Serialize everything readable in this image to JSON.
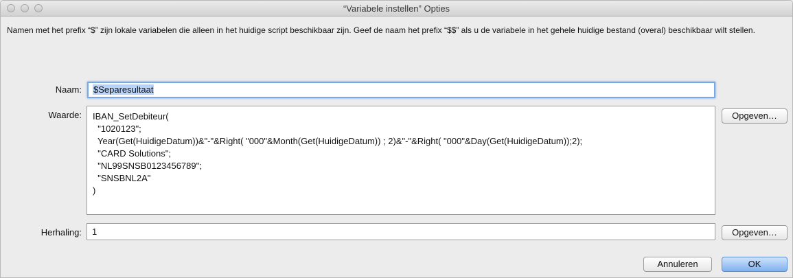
{
  "window": {
    "title": "“Variabele instellen” Opties"
  },
  "description": "Namen met het prefix “$” zijn lokale variabelen die alleen in het huidige script beschikbaar zijn. Geef de naam het prefix “$$” als u de variabele in het gehele huidige bestand (overal) beschikbaar wilt stellen.",
  "name": {
    "label": "Naam:",
    "value": "$Separesultaat"
  },
  "value": {
    "label": "Waarde:",
    "lines": [
      "IBAN_SetDebiteur(",
      "  \"1020123\";",
      "  Year(Get(HuidigeDatum))&\"-\"&Right( \"000\"&Month(Get(HuidigeDatum)) ; 2)&\"-\"&Right( \"000\"&Day(Get(HuidigeDatum));2);",
      "  \"CARD Solutions\";",
      "  \"NL99SNSB0123456789\";",
      "  \"SNSBNL2A\"",
      ")"
    ],
    "specify_button": "Opgeven…"
  },
  "repetition": {
    "label": "Herhaling:",
    "value": "1",
    "specify_button": "Opgeven…"
  },
  "buttons": {
    "cancel": "Annuleren",
    "ok": "OK"
  }
}
